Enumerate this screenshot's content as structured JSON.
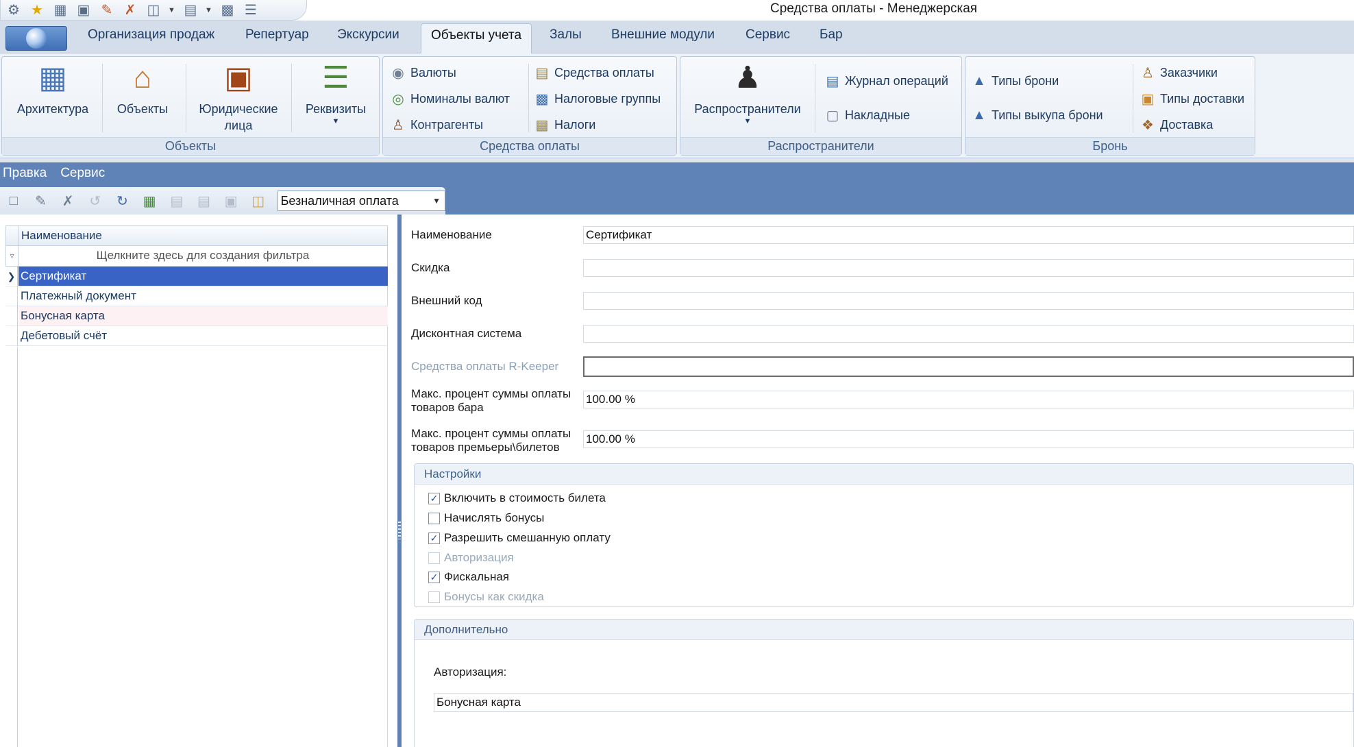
{
  "window": {
    "title": "Средства оплаты - Менеджерская"
  },
  "quick_access": {
    "icons": [
      "app-logo-icon",
      "star-icon",
      "calendar-icon",
      "building-icon",
      "pencil-icon",
      "clear-icon",
      "folder-icon",
      "document-icon",
      "monitor-icon",
      "list-icon"
    ]
  },
  "tabs": [
    {
      "label": "Организация продаж"
    },
    {
      "label": "Репертуар"
    },
    {
      "label": "Экскурсии"
    },
    {
      "label": "Объекты учета"
    },
    {
      "label": "Залы"
    },
    {
      "label": "Внешние модули"
    },
    {
      "label": "Сервис"
    },
    {
      "label": "Бар"
    }
  ],
  "ribbon": {
    "objects": {
      "label": "Объекты",
      "buttons": [
        {
          "label": "Архитектура"
        },
        {
          "label": "Объекты"
        },
        {
          "label": "Юридические лица"
        },
        {
          "label": "Реквизиты"
        }
      ]
    },
    "payment": {
      "label": "Средства оплаты",
      "buttons": [
        {
          "label": "Валюты"
        },
        {
          "label": "Номиналы валют"
        },
        {
          "label": "Контрагенты"
        },
        {
          "label": "Средства оплаты"
        },
        {
          "label": "Налоговые группы"
        },
        {
          "label": "Налоги"
        }
      ]
    },
    "distributors": {
      "label": "Распространители",
      "buttons": [
        {
          "label": "Распространители"
        },
        {
          "label": "Журнал операций"
        },
        {
          "label": "Накладные"
        }
      ]
    },
    "booking": {
      "label": "Бронь",
      "buttons": [
        {
          "label": "Типы брони"
        },
        {
          "label": "Типы выкупа брони"
        },
        {
          "label": "Заказчики"
        },
        {
          "label": "Типы доставки"
        },
        {
          "label": "Доставка"
        }
      ]
    }
  },
  "submenu": {
    "edit": "Правка",
    "service": "Сервис"
  },
  "toolbar": {
    "combo_value": "Безналичная оплата"
  },
  "grid": {
    "header": "Наименование",
    "filter_hint": "Щелкните здесь для создания фильтра",
    "rows": [
      {
        "name": "Сертификат"
      },
      {
        "name": "Платежный документ"
      },
      {
        "name": "Бонусная карта"
      },
      {
        "name": "Дебетовый счёт"
      }
    ]
  },
  "form": {
    "name_label": "Наименование",
    "name_value": "Сертификат",
    "discount_label": "Скидка",
    "discount_value": "",
    "external_code_label": "Внешний код",
    "external_code_value": "",
    "discount_system_label": "Дисконтная система",
    "discount_system_value": "",
    "rkeeper_label": "Средства оплаты R-Keeper",
    "rkeeper_value": "",
    "max_bar_label_1": "Макс. процент суммы оплаты",
    "max_bar_label_2": "товаров бара",
    "max_bar_value": "100.00 %",
    "max_premiere_label_1": "Макс. процент суммы оплаты",
    "max_premiere_label_2": "товаров премьеры\\билетов",
    "max_premiere_value": "100.00 %"
  },
  "settings": {
    "title": "Настройки",
    "items": [
      {
        "label": "Включить в стоимость билета",
        "checked": true,
        "enabled": true
      },
      {
        "label": "Начислять бонусы",
        "checked": false,
        "enabled": true
      },
      {
        "label": "Разрешить смешанную оплату",
        "checked": true,
        "enabled": true
      },
      {
        "label": "Авторизация",
        "checked": false,
        "enabled": false
      },
      {
        "label": "Фискальная",
        "checked": true,
        "enabled": true
      },
      {
        "label": "Бонусы как скидка",
        "checked": false,
        "enabled": false
      }
    ]
  },
  "additional": {
    "title": "Дополнительно",
    "auth_label": "Авторизация:",
    "auth_value": "Бонусная карта"
  }
}
